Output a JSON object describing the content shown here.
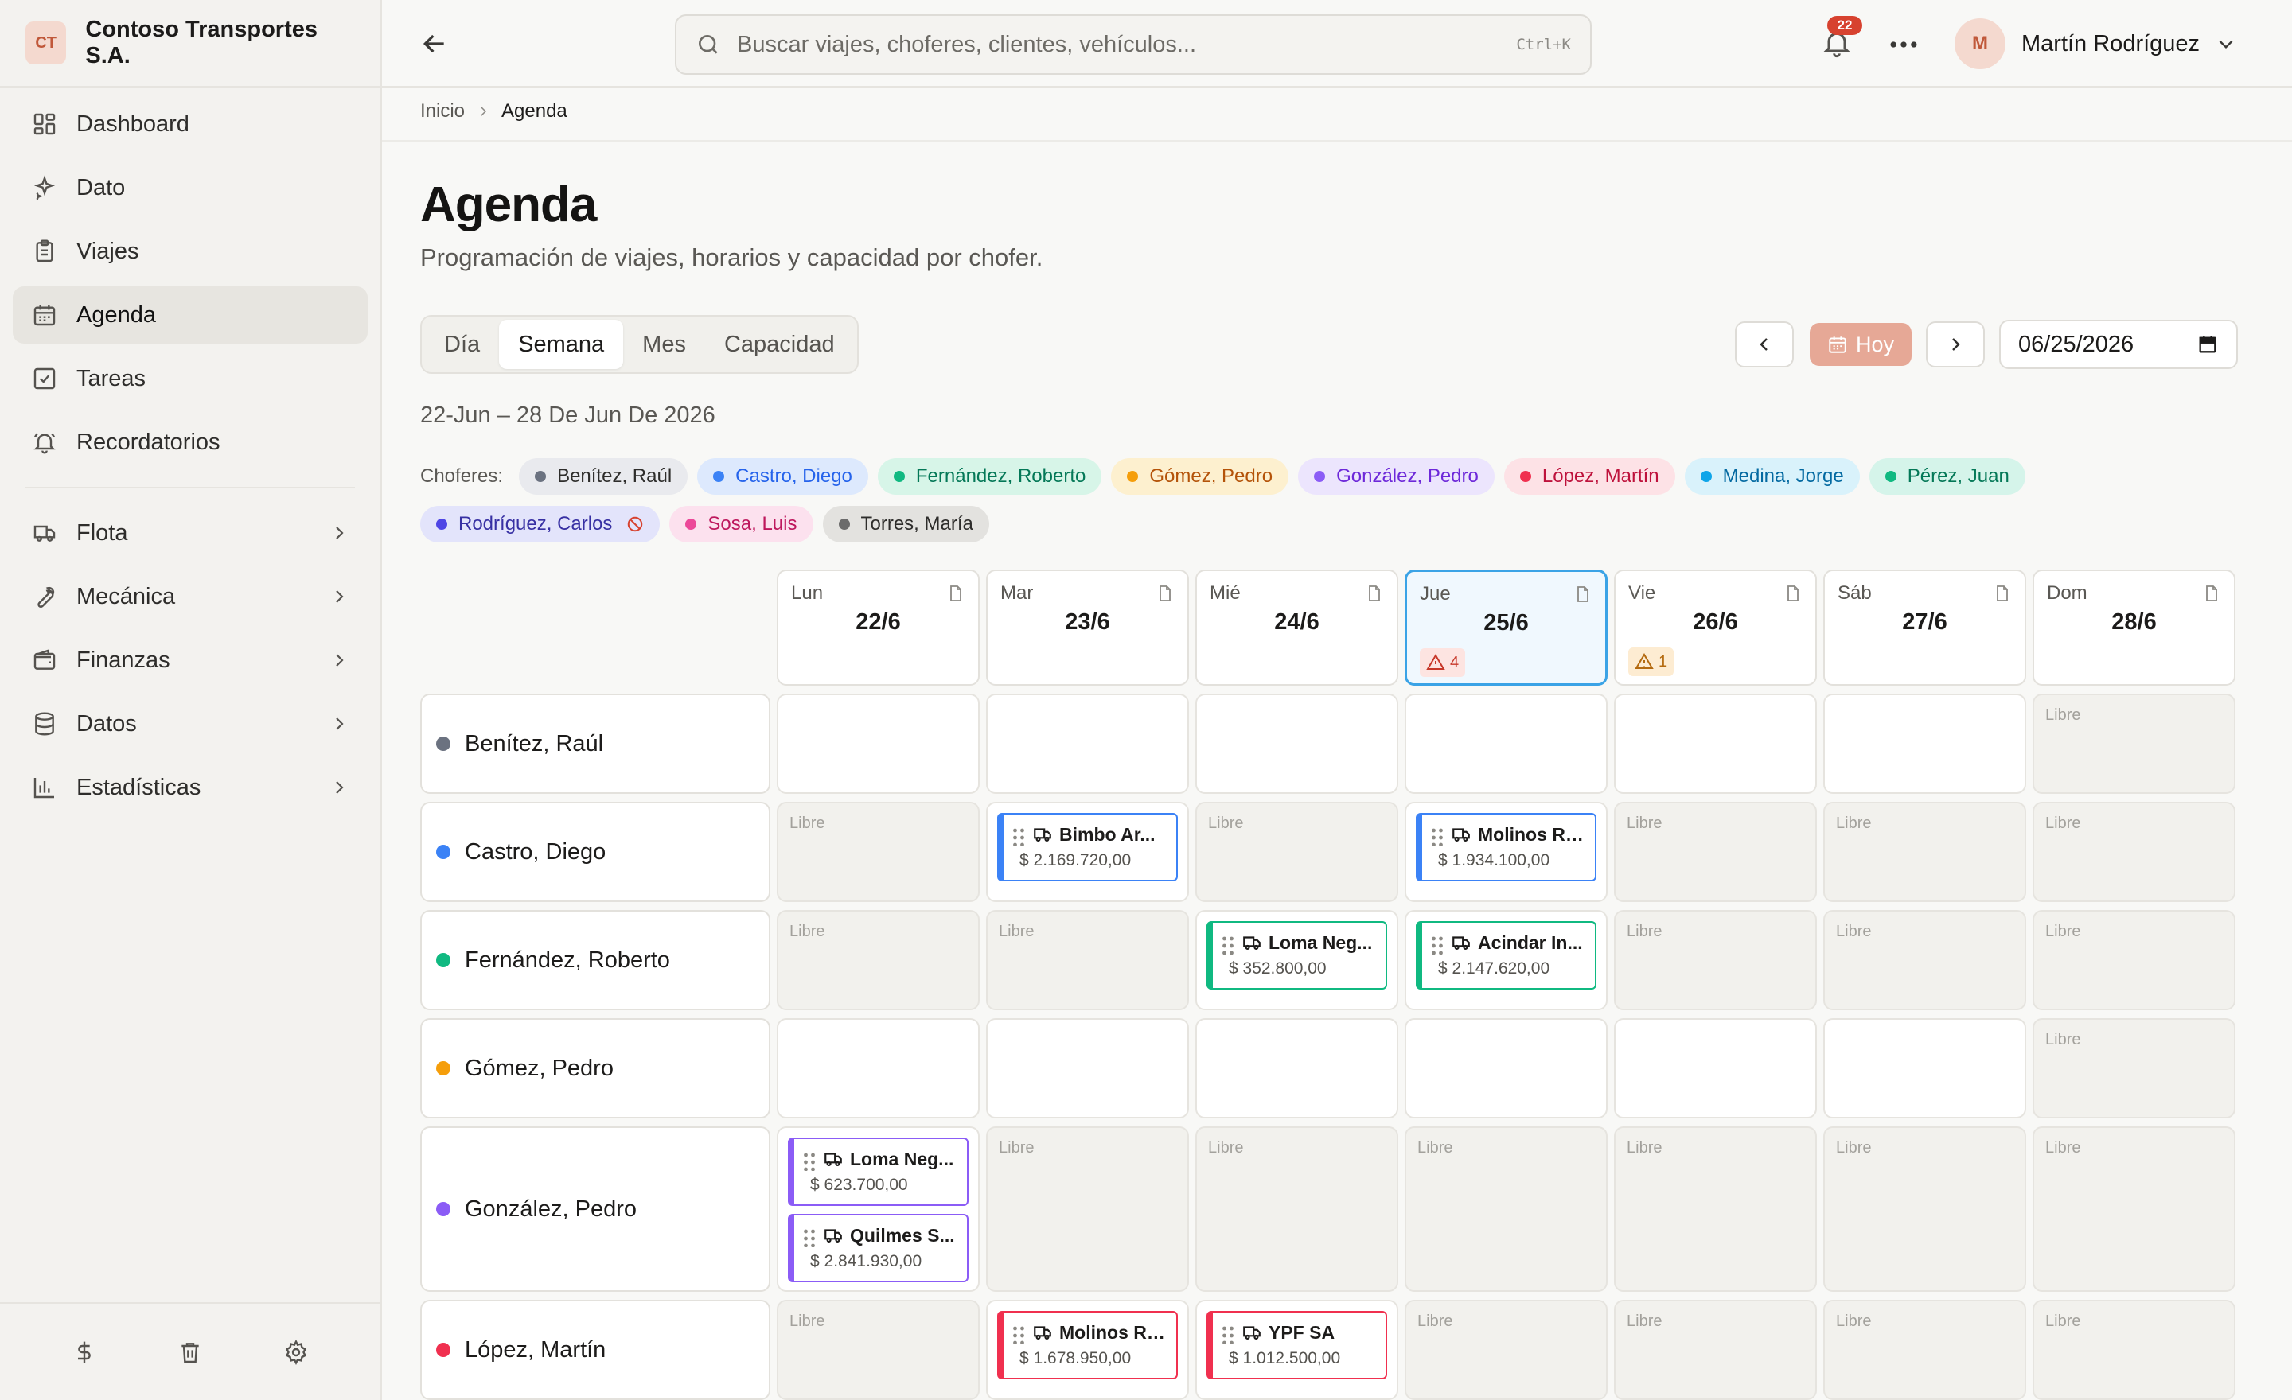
{
  "sidebar": {
    "logo": "CT",
    "company": "Contoso Transportes S.A.",
    "items": [
      {
        "label": "Dashboard",
        "icon": "dashboard-icon"
      },
      {
        "label": "Dato",
        "icon": "sparkle-icon"
      },
      {
        "label": "Viajes",
        "icon": "clipboard-icon"
      },
      {
        "label": "Agenda",
        "icon": "calendar-icon",
        "active": true
      },
      {
        "label": "Tareas",
        "icon": "checkbox-icon"
      },
      {
        "label": "Recordatorios",
        "icon": "bell-icon"
      }
    ],
    "groups": [
      {
        "label": "Flota",
        "icon": "truck-icon"
      },
      {
        "label": "Mecánica",
        "icon": "wrench-icon"
      },
      {
        "label": "Finanzas",
        "icon": "wallet-icon"
      },
      {
        "label": "Datos",
        "icon": "database-icon"
      },
      {
        "label": "Estadísticas",
        "icon": "bar-chart-icon"
      }
    ],
    "footer": [
      "dollar-icon",
      "trash-icon",
      "gear-icon"
    ]
  },
  "topbar": {
    "search_placeholder": "Buscar viajes, choferes, clientes, vehículos...",
    "shortcut": "Ctrl+K",
    "notifications": "22",
    "user_initial": "M",
    "user_name": "Martín Rodríguez"
  },
  "breadcrumb": {
    "home": "Inicio",
    "current": "Agenda"
  },
  "page": {
    "title": "Agenda",
    "subtitle": "Programación de viajes, horarios y capacidad por chofer.",
    "tabs": [
      {
        "label": "Día",
        "active": false
      },
      {
        "label": "Semana",
        "active": true
      },
      {
        "label": "Mes",
        "active": false
      },
      {
        "label": "Capacidad",
        "active": false
      }
    ],
    "today_label": "Hoy",
    "date_value": "06/25/2026",
    "range": "22-Jun – 28 De Jun De 2026",
    "choferes_label": "Choferes:"
  },
  "colors": {
    "slate": "#6b7280",
    "blue": "#3b82f6",
    "green": "#10b981",
    "amber": "#f59e0b",
    "violet": "#8b5cf6",
    "red": "#f0304f",
    "cyan": "#0ea5e9",
    "emerald": "#10b981",
    "indigo": "#4f46e5",
    "pink": "#ec4899",
    "gray": "#6b6b6b",
    "accent": "#e6a896"
  },
  "drivers": [
    {
      "name": "Benítez, Raúl",
      "color": "#6b7280",
      "chip_bg": "#e9eaee",
      "chip_fg": "#2e2d2b"
    },
    {
      "name": "Castro, Diego",
      "color": "#3b82f6",
      "chip_bg": "#dde9fd",
      "chip_fg": "#2563eb"
    },
    {
      "name": "Fernández, Roberto",
      "color": "#10b981",
      "chip_bg": "#d7f5e8",
      "chip_fg": "#047857"
    },
    {
      "name": "Gómez, Pedro",
      "color": "#f59e0b",
      "chip_bg": "#fdf0cf",
      "chip_fg": "#b45309"
    },
    {
      "name": "González, Pedro",
      "color": "#8b5cf6",
      "chip_bg": "#ece5fd",
      "chip_fg": "#6d28d9"
    },
    {
      "name": "López, Martín",
      "color": "#f0304f",
      "chip_bg": "#fde2e6",
      "chip_fg": "#be123c"
    },
    {
      "name": "Medina, Jorge",
      "color": "#0ea5e9",
      "chip_bg": "#d9f2fb",
      "chip_fg": "#0369a1"
    },
    {
      "name": "Pérez, Juan",
      "color": "#10b981",
      "chip_bg": "#d5f4ea",
      "chip_fg": "#047857"
    },
    {
      "name": "Rodríguez, Carlos",
      "color": "#4f46e5",
      "chip_bg": "#e3e4fb",
      "chip_fg": "#3730a3",
      "blocked": true
    },
    {
      "name": "Sosa, Luis",
      "color": "#ec4899",
      "chip_bg": "#fce1ee",
      "chip_fg": "#be185d"
    },
    {
      "name": "Torres, María",
      "color": "#6b6b6b",
      "chip_bg": "#e3e2df",
      "chip_fg": "#2e2d2b"
    }
  ],
  "days": [
    {
      "name": "Lun",
      "date": "22/6",
      "alert": null
    },
    {
      "name": "Mar",
      "date": "23/6",
      "alert": null
    },
    {
      "name": "Mié",
      "date": "24/6",
      "alert": null
    },
    {
      "name": "Jue",
      "date": "25/6",
      "alert": {
        "count": "4",
        "level": "red"
      },
      "today": true
    },
    {
      "name": "Vie",
      "date": "26/6",
      "alert": {
        "count": "1",
        "level": "amber"
      }
    },
    {
      "name": "Sáb",
      "date": "27/6",
      "alert": null
    },
    {
      "name": "Dom",
      "date": "28/6",
      "alert": null
    }
  ],
  "free_label": "Libre",
  "rows": [
    {
      "driver": "Benítez, Raúl",
      "color": "#6b7280",
      "height": "normal",
      "cells": [
        {
          "state": "empty"
        },
        {
          "state": "empty"
        },
        {
          "state": "empty"
        },
        {
          "state": "empty"
        },
        {
          "state": "empty"
        },
        {
          "state": "empty"
        },
        {
          "state": "free"
        }
      ]
    },
    {
      "driver": "Castro, Diego",
      "color": "#3b82f6",
      "height": "normal",
      "cells": [
        {
          "state": "free"
        },
        {
          "state": "trips",
          "trips": [
            {
              "client": "Bimbo Ar...",
              "amount": "$ 2.169.720,00"
            }
          ]
        },
        {
          "state": "free"
        },
        {
          "state": "trips",
          "trips": [
            {
              "client": "Molinos Rí...",
              "amount": "$ 1.934.100,00"
            }
          ]
        },
        {
          "state": "free"
        },
        {
          "state": "free"
        },
        {
          "state": "free"
        }
      ]
    },
    {
      "driver": "Fernández, Roberto",
      "color": "#10b981",
      "height": "normal",
      "cells": [
        {
          "state": "free"
        },
        {
          "state": "free"
        },
        {
          "state": "trips",
          "trips": [
            {
              "client": "Loma Neg...",
              "amount": "$ 352.800,00"
            }
          ]
        },
        {
          "state": "trips",
          "trips": [
            {
              "client": "Acindar In...",
              "amount": "$ 2.147.620,00"
            }
          ]
        },
        {
          "state": "free"
        },
        {
          "state": "free"
        },
        {
          "state": "free"
        }
      ]
    },
    {
      "driver": "Gómez, Pedro",
      "color": "#f59e0b",
      "height": "normal",
      "cells": [
        {
          "state": "empty"
        },
        {
          "state": "empty"
        },
        {
          "state": "empty"
        },
        {
          "state": "empty"
        },
        {
          "state": "empty"
        },
        {
          "state": "empty"
        },
        {
          "state": "free"
        }
      ]
    },
    {
      "driver": "González, Pedro",
      "color": "#8b5cf6",
      "height": "tall",
      "cells": [
        {
          "state": "trips",
          "trips": [
            {
              "client": "Loma Neg...",
              "amount": "$ 623.700,00"
            },
            {
              "client": "Quilmes S...",
              "amount": "$ 2.841.930,00"
            }
          ]
        },
        {
          "state": "free"
        },
        {
          "state": "free"
        },
        {
          "state": "free"
        },
        {
          "state": "free"
        },
        {
          "state": "free"
        },
        {
          "state": "free"
        }
      ]
    },
    {
      "driver": "López, Martín",
      "color": "#f0304f",
      "height": "normal",
      "cells": [
        {
          "state": "free"
        },
        {
          "state": "trips",
          "trips": [
            {
              "client": "Molinos Rí...",
              "amount": "$ 1.678.950,00"
            }
          ]
        },
        {
          "state": "trips",
          "trips": [
            {
              "client": "YPF SA",
              "amount": "$ 1.012.500,00"
            }
          ]
        },
        {
          "state": "free"
        },
        {
          "state": "free"
        },
        {
          "state": "free"
        },
        {
          "state": "free"
        }
      ]
    }
  ]
}
